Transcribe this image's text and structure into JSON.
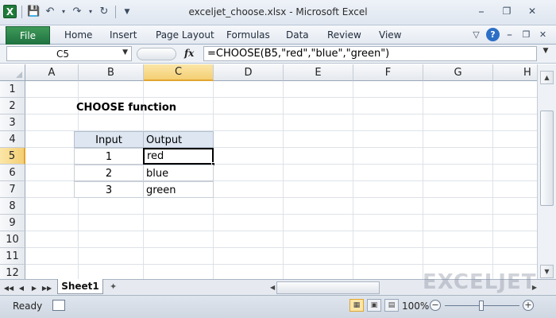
{
  "window": {
    "title": "exceljet_choose.xlsx - Microsoft Excel",
    "logo_letter": "X"
  },
  "ribbon": {
    "file_label": "File",
    "tabs": [
      "Home",
      "Insert",
      "Page Layout",
      "Formulas",
      "Data",
      "Review",
      "View"
    ]
  },
  "formula_bar": {
    "name_box": "C5",
    "fx_label": "fx",
    "formula": "=CHOOSE(B5,\"red\",\"blue\",\"green\")"
  },
  "grid": {
    "columns": [
      "A",
      "B",
      "C",
      "D",
      "E",
      "F",
      "G",
      "H"
    ],
    "rows": [
      "1",
      "2",
      "3",
      "4",
      "5",
      "6",
      "7",
      "8",
      "9",
      "10",
      "11",
      "12"
    ],
    "selected_column": "C",
    "selected_row": "5",
    "title": "CHOOSE function",
    "table": {
      "headers": [
        "Input",
        "Output"
      ],
      "rows": [
        [
          "1",
          "red"
        ],
        [
          "2",
          "blue"
        ],
        [
          "3",
          "green"
        ]
      ]
    }
  },
  "sheets": {
    "active": "Sheet1"
  },
  "watermark": "EXCELJET",
  "status": {
    "ready": "Ready",
    "zoom": "100%",
    "zoom_level_percent": 100
  }
}
